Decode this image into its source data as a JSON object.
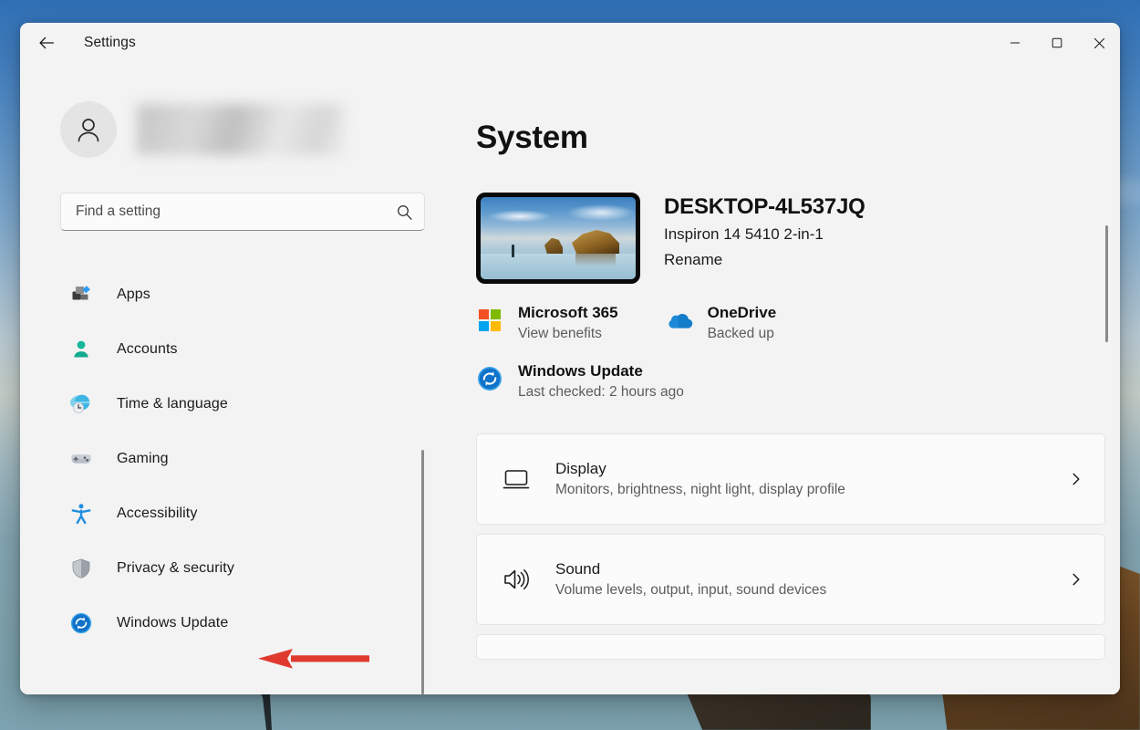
{
  "window": {
    "title": "Settings",
    "back_icon": "back-arrow-icon",
    "controls": {
      "minimize": "minimize-icon",
      "maximize": "maximize-icon",
      "close": "close-icon"
    }
  },
  "sidebar": {
    "account": {
      "avatar_icon": "person-avatar-icon",
      "name": ""
    },
    "search": {
      "placeholder": "Find a setting",
      "value": "",
      "icon": "search-icon"
    },
    "items": [
      {
        "label": "Apps",
        "icon": "apps-icon"
      },
      {
        "label": "Accounts",
        "icon": "accounts-person-icon"
      },
      {
        "label": "Time & language",
        "icon": "time-language-globe-clock-icon"
      },
      {
        "label": "Gaming",
        "icon": "gaming-controller-icon"
      },
      {
        "label": "Accessibility",
        "icon": "accessibility-person-icon"
      },
      {
        "label": "Privacy & security",
        "icon": "shield-icon"
      },
      {
        "label": "Windows Update",
        "icon": "windows-update-sync-icon"
      }
    ]
  },
  "main": {
    "page_title": "System",
    "device": {
      "thumbnail_icon": "device-wallpaper-thumbnail",
      "name": "DESKTOP-4L537JQ",
      "model": "Inspiron 14 5410 2-in-1",
      "rename_label": "Rename"
    },
    "status": [
      {
        "title": "Microsoft 365",
        "subtitle": "View benefits",
        "icon": "microsoft-logo-icon"
      },
      {
        "title": "OneDrive",
        "subtitle": "Backed up",
        "icon": "onedrive-cloud-icon"
      },
      {
        "title": "Windows Update",
        "subtitle": "Last checked: 2 hours ago",
        "icon": "windows-update-sync-icon"
      }
    ],
    "cards": [
      {
        "title": "Display",
        "subtitle": "Monitors, brightness, night light, display profile",
        "icon": "monitor-icon",
        "chevron": "chevron-right-icon"
      },
      {
        "title": "Sound",
        "subtitle": "Volume levels, output, input, sound devices",
        "icon": "speaker-icon",
        "chevron": "chevron-right-icon"
      }
    ]
  },
  "annotation": {
    "arrow_color": "#e03a2f",
    "points_at": "Windows Update"
  },
  "colors": {
    "window_background": "#f3f3f3",
    "card_background": "#fbfbfb",
    "text_primary": "#1b1b1b",
    "text_secondary": "#5c5c5c",
    "accent_blue": "#0078d4",
    "annotation_red": "#e03a2f"
  }
}
